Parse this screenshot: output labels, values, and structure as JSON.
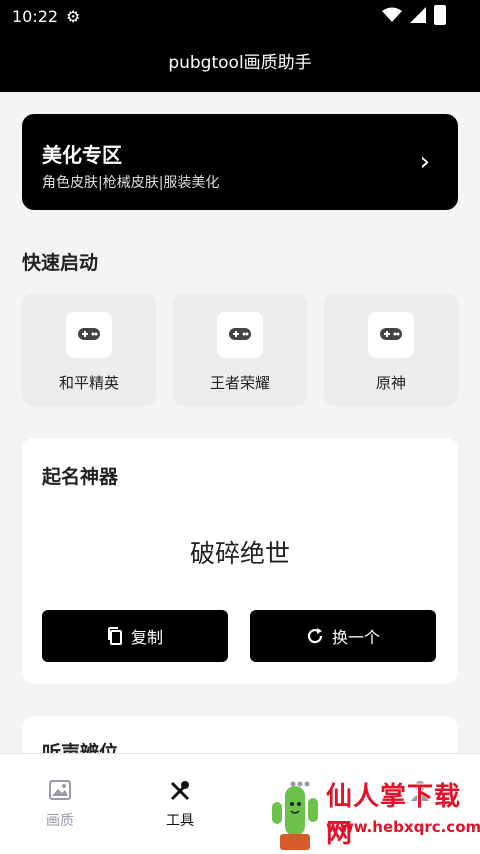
{
  "status": {
    "time": "10:22"
  },
  "appbar": {
    "title": "pubgtool画质助手"
  },
  "promo": {
    "title": "美化专区",
    "subtitle": "角色皮肤|枪械皮肤|服装美化"
  },
  "quick_start": {
    "title": "快速启动",
    "items": [
      {
        "label": "和平精英"
      },
      {
        "label": "王者荣耀"
      },
      {
        "label": "原神"
      }
    ]
  },
  "name_generator": {
    "title": "起名神器",
    "name": "破碎绝世",
    "copy_label": "复制",
    "refresh_label": "换一个"
  },
  "next_section": {
    "title": "听声辨位"
  },
  "bottom_nav": {
    "items": [
      {
        "label": "画质"
      },
      {
        "label": "工具"
      },
      {
        "label": ""
      },
      {
        "label": ""
      }
    ]
  },
  "watermark": {
    "title": "仙人掌下载网",
    "url": "www.hebxqrc.com"
  }
}
